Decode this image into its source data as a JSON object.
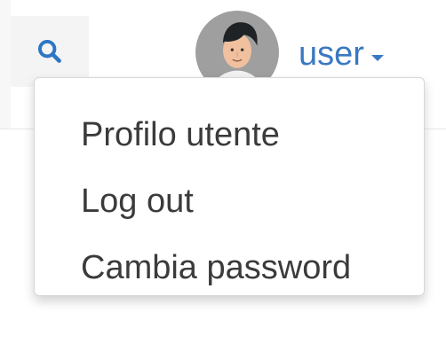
{
  "header": {
    "search_icon": "search-icon",
    "user_label": "user",
    "caret_icon": "chevron-down-icon",
    "avatar_icon": "avatar"
  },
  "menu": {
    "items": [
      {
        "label": "Profilo utente"
      },
      {
        "label": "Log out"
      },
      {
        "label": "Cambia password"
      }
    ]
  },
  "colors": {
    "accent": "#3a79c1",
    "text": "#3b3b3b",
    "border": "#d7d7d7"
  }
}
